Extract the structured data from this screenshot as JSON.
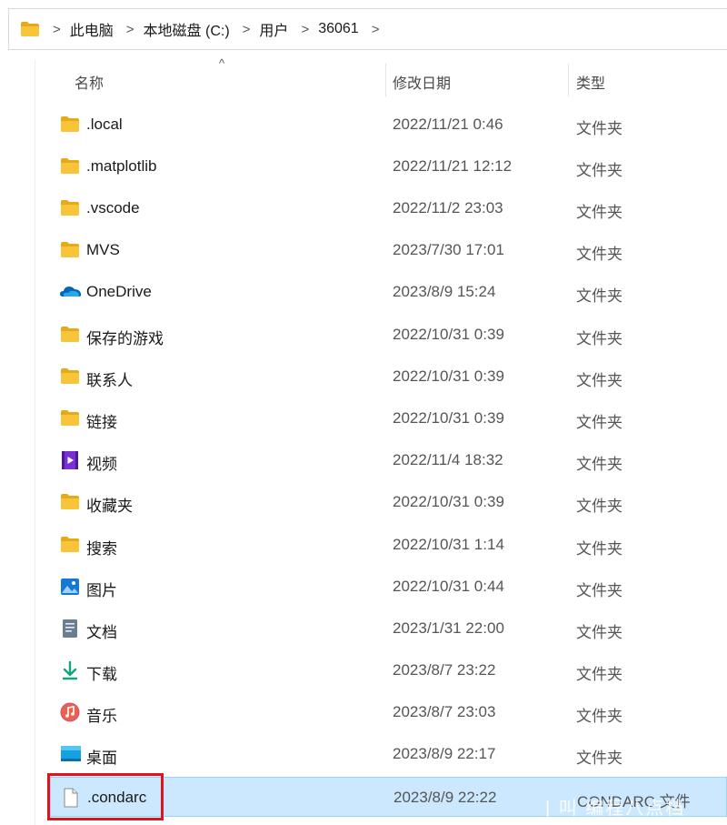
{
  "breadcrumb": [
    "此电脑",
    "本地磁盘 (C:)",
    "用户",
    "36061"
  ],
  "columns": {
    "name": "名称",
    "date": "修改日期",
    "type": "类型",
    "sort_indicator": "^"
  },
  "files": [
    {
      "name": ".local",
      "date": "2022/11/21 0:46",
      "type": "文件夹",
      "icon": "folder-icon"
    },
    {
      "name": ".matplotlib",
      "date": "2022/11/21 12:12",
      "type": "文件夹",
      "icon": "folder-icon"
    },
    {
      "name": ".vscode",
      "date": "2022/11/2 23:03",
      "type": "文件夹",
      "icon": "folder-icon"
    },
    {
      "name": "MVS",
      "date": "2023/7/30 17:01",
      "type": "文件夹",
      "icon": "folder-icon"
    },
    {
      "name": "OneDrive",
      "date": "2023/8/9 15:24",
      "type": "文件夹",
      "icon": "onedrive-cloud-icon"
    },
    {
      "name": "保存的游戏",
      "date": "2022/10/31 0:39",
      "type": "文件夹",
      "icon": "folder-icon"
    },
    {
      "name": "联系人",
      "date": "2022/10/31 0:39",
      "type": "文件夹",
      "icon": "folder-icon"
    },
    {
      "name": "链接",
      "date": "2022/10/31 0:39",
      "type": "文件夹",
      "icon": "folder-icon"
    },
    {
      "name": "视频",
      "date": "2022/11/4 18:32",
      "type": "文件夹",
      "icon": "videos-icon"
    },
    {
      "name": "收藏夹",
      "date": "2022/10/31 0:39",
      "type": "文件夹",
      "icon": "folder-icon"
    },
    {
      "name": "搜索",
      "date": "2022/10/31 1:14",
      "type": "文件夹",
      "icon": "folder-icon"
    },
    {
      "name": "图片",
      "date": "2022/10/31 0:44",
      "type": "文件夹",
      "icon": "pictures-icon"
    },
    {
      "name": "文档",
      "date": "2023/1/31 22:00",
      "type": "文件夹",
      "icon": "documents-icon"
    },
    {
      "name": "下载",
      "date": "2023/8/7 23:22",
      "type": "文件夹",
      "icon": "download-icon"
    },
    {
      "name": "音乐",
      "date": "2023/8/7 23:03",
      "type": "文件夹",
      "icon": "music-icon"
    },
    {
      "name": "桌面",
      "date": "2023/8/9 22:17",
      "type": "文件夹",
      "icon": "desktop-icon"
    },
    {
      "name": ".condarc",
      "date": "2023/8/9 22:22",
      "type": "CONDARC 文件",
      "icon": "file-icon",
      "selected": true
    }
  ],
  "watermark": "| 叫 编程八点档",
  "colors": {
    "selection": "#cce8ff",
    "selection_border": "#99d1ff",
    "highlight": "#e0141e",
    "folder": "#f8c53a"
  }
}
